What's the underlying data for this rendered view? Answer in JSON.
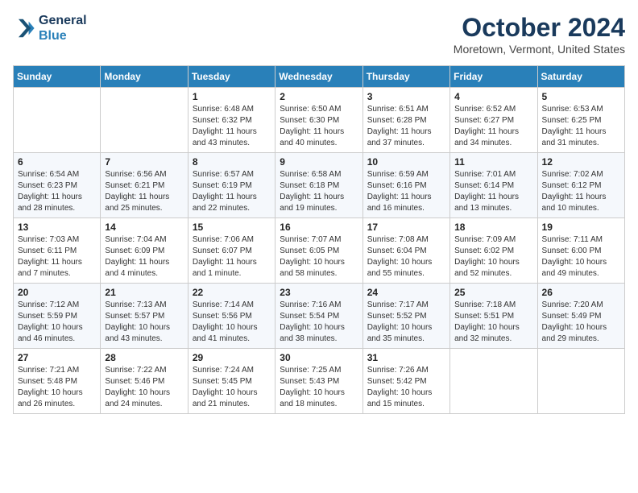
{
  "logo": {
    "line1": "General",
    "line2": "Blue"
  },
  "title": "October 2024",
  "location": "Moretown, Vermont, United States",
  "headers": [
    "Sunday",
    "Monday",
    "Tuesday",
    "Wednesday",
    "Thursday",
    "Friday",
    "Saturday"
  ],
  "weeks": [
    [
      {
        "day": "",
        "info": ""
      },
      {
        "day": "",
        "info": ""
      },
      {
        "day": "1",
        "info": "Sunrise: 6:48 AM\nSunset: 6:32 PM\nDaylight: 11 hours and 43 minutes."
      },
      {
        "day": "2",
        "info": "Sunrise: 6:50 AM\nSunset: 6:30 PM\nDaylight: 11 hours and 40 minutes."
      },
      {
        "day": "3",
        "info": "Sunrise: 6:51 AM\nSunset: 6:28 PM\nDaylight: 11 hours and 37 minutes."
      },
      {
        "day": "4",
        "info": "Sunrise: 6:52 AM\nSunset: 6:27 PM\nDaylight: 11 hours and 34 minutes."
      },
      {
        "day": "5",
        "info": "Sunrise: 6:53 AM\nSunset: 6:25 PM\nDaylight: 11 hours and 31 minutes."
      }
    ],
    [
      {
        "day": "6",
        "info": "Sunrise: 6:54 AM\nSunset: 6:23 PM\nDaylight: 11 hours and 28 minutes."
      },
      {
        "day": "7",
        "info": "Sunrise: 6:56 AM\nSunset: 6:21 PM\nDaylight: 11 hours and 25 minutes."
      },
      {
        "day": "8",
        "info": "Sunrise: 6:57 AM\nSunset: 6:19 PM\nDaylight: 11 hours and 22 minutes."
      },
      {
        "day": "9",
        "info": "Sunrise: 6:58 AM\nSunset: 6:18 PM\nDaylight: 11 hours and 19 minutes."
      },
      {
        "day": "10",
        "info": "Sunrise: 6:59 AM\nSunset: 6:16 PM\nDaylight: 11 hours and 16 minutes."
      },
      {
        "day": "11",
        "info": "Sunrise: 7:01 AM\nSunset: 6:14 PM\nDaylight: 11 hours and 13 minutes."
      },
      {
        "day": "12",
        "info": "Sunrise: 7:02 AM\nSunset: 6:12 PM\nDaylight: 11 hours and 10 minutes."
      }
    ],
    [
      {
        "day": "13",
        "info": "Sunrise: 7:03 AM\nSunset: 6:11 PM\nDaylight: 11 hours and 7 minutes."
      },
      {
        "day": "14",
        "info": "Sunrise: 7:04 AM\nSunset: 6:09 PM\nDaylight: 11 hours and 4 minutes."
      },
      {
        "day": "15",
        "info": "Sunrise: 7:06 AM\nSunset: 6:07 PM\nDaylight: 11 hours and 1 minute."
      },
      {
        "day": "16",
        "info": "Sunrise: 7:07 AM\nSunset: 6:05 PM\nDaylight: 10 hours and 58 minutes."
      },
      {
        "day": "17",
        "info": "Sunrise: 7:08 AM\nSunset: 6:04 PM\nDaylight: 10 hours and 55 minutes."
      },
      {
        "day": "18",
        "info": "Sunrise: 7:09 AM\nSunset: 6:02 PM\nDaylight: 10 hours and 52 minutes."
      },
      {
        "day": "19",
        "info": "Sunrise: 7:11 AM\nSunset: 6:00 PM\nDaylight: 10 hours and 49 minutes."
      }
    ],
    [
      {
        "day": "20",
        "info": "Sunrise: 7:12 AM\nSunset: 5:59 PM\nDaylight: 10 hours and 46 minutes."
      },
      {
        "day": "21",
        "info": "Sunrise: 7:13 AM\nSunset: 5:57 PM\nDaylight: 10 hours and 43 minutes."
      },
      {
        "day": "22",
        "info": "Sunrise: 7:14 AM\nSunset: 5:56 PM\nDaylight: 10 hours and 41 minutes."
      },
      {
        "day": "23",
        "info": "Sunrise: 7:16 AM\nSunset: 5:54 PM\nDaylight: 10 hours and 38 minutes."
      },
      {
        "day": "24",
        "info": "Sunrise: 7:17 AM\nSunset: 5:52 PM\nDaylight: 10 hours and 35 minutes."
      },
      {
        "day": "25",
        "info": "Sunrise: 7:18 AM\nSunset: 5:51 PM\nDaylight: 10 hours and 32 minutes."
      },
      {
        "day": "26",
        "info": "Sunrise: 7:20 AM\nSunset: 5:49 PM\nDaylight: 10 hours and 29 minutes."
      }
    ],
    [
      {
        "day": "27",
        "info": "Sunrise: 7:21 AM\nSunset: 5:48 PM\nDaylight: 10 hours and 26 minutes."
      },
      {
        "day": "28",
        "info": "Sunrise: 7:22 AM\nSunset: 5:46 PM\nDaylight: 10 hours and 24 minutes."
      },
      {
        "day": "29",
        "info": "Sunrise: 7:24 AM\nSunset: 5:45 PM\nDaylight: 10 hours and 21 minutes."
      },
      {
        "day": "30",
        "info": "Sunrise: 7:25 AM\nSunset: 5:43 PM\nDaylight: 10 hours and 18 minutes."
      },
      {
        "day": "31",
        "info": "Sunrise: 7:26 AM\nSunset: 5:42 PM\nDaylight: 10 hours and 15 minutes."
      },
      {
        "day": "",
        "info": ""
      },
      {
        "day": "",
        "info": ""
      }
    ]
  ]
}
